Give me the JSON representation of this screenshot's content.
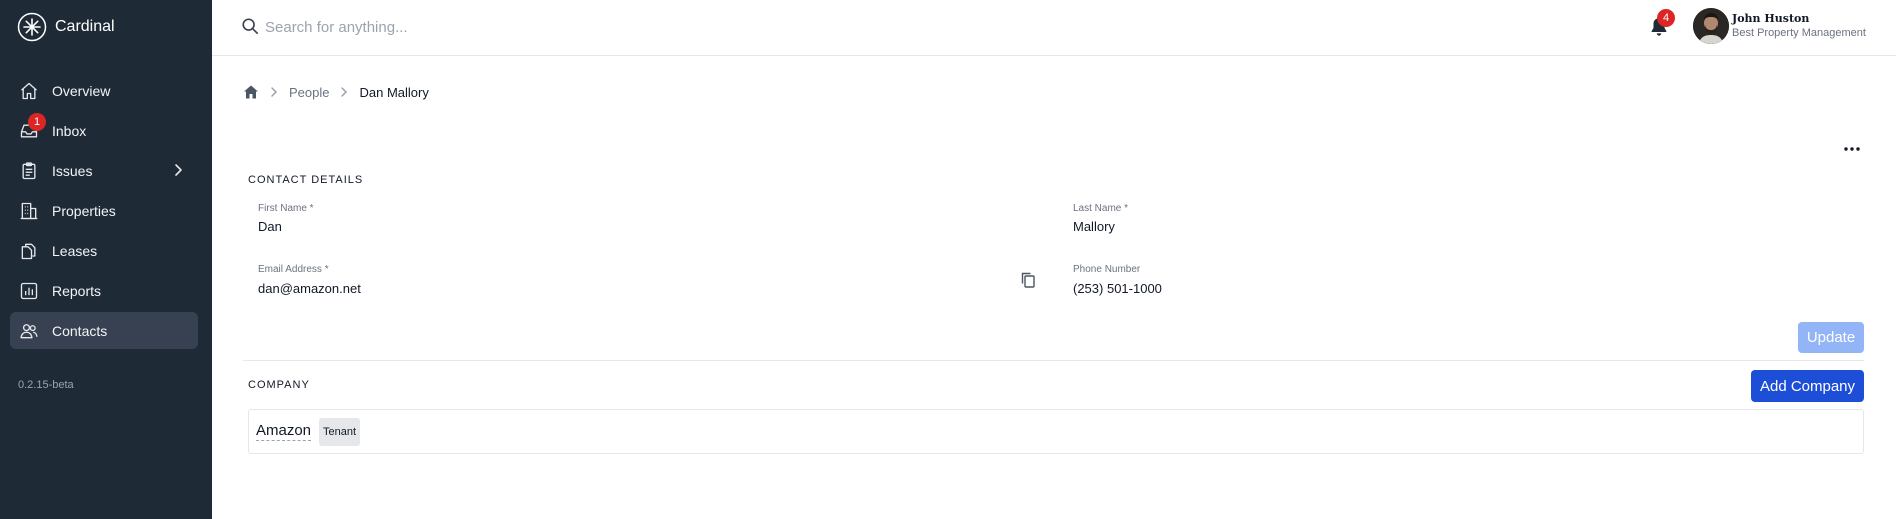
{
  "app": {
    "name": "Cardinal",
    "version": "0.2.15-beta"
  },
  "sidebar": {
    "items": [
      {
        "label": "Overview",
        "icon": "home-icon"
      },
      {
        "label": "Inbox",
        "icon": "inbox-icon",
        "badge": "1"
      },
      {
        "label": "Issues",
        "icon": "clipboard-icon"
      },
      {
        "label": "Properties",
        "icon": "building-icon"
      },
      {
        "label": "Leases",
        "icon": "documents-icon"
      },
      {
        "label": "Reports",
        "icon": "chart-icon"
      },
      {
        "label": "Contacts",
        "icon": "users-icon",
        "active": true
      }
    ]
  },
  "header": {
    "search_placeholder": "Search for anything...",
    "notifications_count": "4",
    "user": {
      "name": "John Huston",
      "company": "Best Property Management"
    }
  },
  "breadcrumb": {
    "parent": "People",
    "current": "Dan Mallory"
  },
  "contact": {
    "section_title": "CONTACT DETAILS",
    "first_name_label": "First Name *",
    "first_name": "Dan",
    "last_name_label": "Last Name *",
    "last_name": "Mallory",
    "email_label": "Email Address *",
    "email": "dan@amazon.net",
    "phone_label": "Phone Number",
    "phone": "(253) 501-1000",
    "update_label": "Update"
  },
  "company": {
    "section_title": "COMPANY",
    "add_label": "Add Company",
    "items": [
      {
        "name": "Amazon",
        "tag": "Tenant"
      }
    ]
  },
  "colors": {
    "sidebar": "#1f2a37",
    "accent": "#1d4ed8",
    "badge": "#dc2626"
  }
}
